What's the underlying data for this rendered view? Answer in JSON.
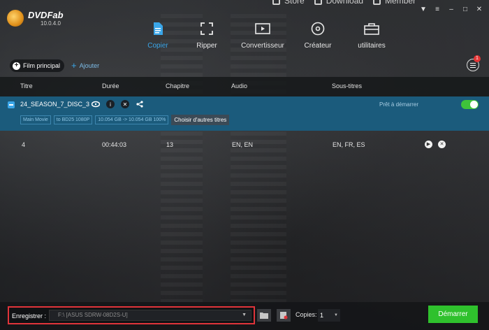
{
  "app": {
    "name": "DVDFab",
    "version": "10.0.4.0"
  },
  "top_links": [
    {
      "label": "Store"
    },
    {
      "label": "Download"
    },
    {
      "label": "Member"
    }
  ],
  "window_controls": [
    "▼",
    "≡",
    "–",
    "□",
    "✕"
  ],
  "nav": [
    {
      "label": "Copier",
      "icon": "copy-document-icon",
      "active": true
    },
    {
      "label": "Ripper",
      "icon": "ripper-icon",
      "active": false
    },
    {
      "label": "Convertisseur",
      "icon": "converter-film-icon",
      "active": false
    },
    {
      "label": "Créateur",
      "icon": "disc-creator-icon",
      "active": false
    },
    {
      "label": "utilitaires",
      "icon": "toolbox-icon",
      "active": false
    }
  ],
  "subbar": {
    "main_movie_label": "Film principal",
    "add_label": "Ajouter",
    "menu_badge": "1"
  },
  "table": {
    "headers": {
      "title": "Titre",
      "duration": "Durée",
      "chapter": "Chapitre",
      "audio": "Audio",
      "subtitles": "Sous-titres"
    },
    "group": {
      "name": "24_SEASON_7_DISC_3",
      "status": "Prêt à démarrer",
      "tags": [
        "Main Movie",
        "to BD25 1080P",
        "10.054 GB -> 10.054 GB 100%"
      ],
      "choose_titles_label": "Choisir d'autres titres"
    },
    "rows": [
      {
        "title": "4",
        "duration": "00:44:03",
        "chapter": "13",
        "audio": "EN, EN",
        "subtitles": "EN, FR, ES"
      }
    ]
  },
  "footer": {
    "save_label": "Enregistrer :",
    "save_value": "F:\\ [ASUS SDRW-08D2S-U]",
    "copies_label": "Copies:",
    "copies_value": "1",
    "start_label": "Démarrer"
  },
  "colors": {
    "accent": "#3aa6e8",
    "start": "#2fc12d",
    "highlight": "#e0343a",
    "group_row": "#1b5b7c"
  }
}
